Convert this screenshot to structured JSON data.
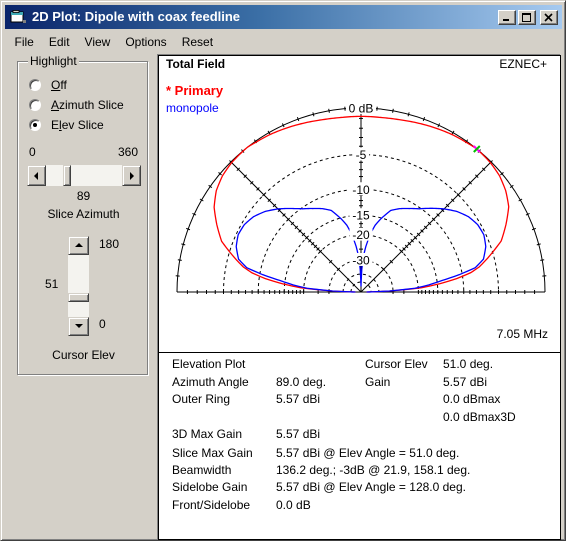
{
  "window": {
    "title": "2D Plot: Dipole with coax feedline"
  },
  "menu": [
    "File",
    "Edit",
    "View",
    "Options",
    "Reset"
  ],
  "highlight": {
    "legend": "Highlight",
    "options": [
      {
        "pre": "",
        "key": "O",
        "post": "ff",
        "selected": false
      },
      {
        "pre": "",
        "key": "A",
        "post": "zimuth Slice",
        "selected": false
      },
      {
        "pre": "E",
        "key": "l",
        "post": "ev Slice",
        "selected": true
      }
    ],
    "slice_azimuth": {
      "min": 0,
      "max": 360,
      "value": 89,
      "label": "Slice Azimuth"
    },
    "cursor_elev": {
      "min": 0,
      "max": 180,
      "value": 51,
      "label": "Cursor Elev"
    }
  },
  "plot": {
    "title": "Total Field",
    "brand": "EZNEC+",
    "legend": [
      {
        "text": "* Primary",
        "color": "#FF0000"
      },
      {
        "text": "monopole",
        "color": "#0000FF"
      }
    ],
    "frequency": "7.05 MHz"
  },
  "chart_data": {
    "type": "line",
    "coordinate_system": "polar-half (elevation 0-180 deg)",
    "title": "Total Field",
    "radial_scale": "arrl-log",
    "radial_range_db": [
      -50,
      0
    ],
    "rings_db": [
      0,
      -5,
      -10,
      -15,
      -20,
      -30,
      -40,
      -50
    ],
    "ring_labels": [
      "0 dB",
      "-5",
      "-10",
      "-15",
      "-20",
      "-30"
    ],
    "spokes_deg": [
      45,
      90,
      135
    ],
    "outer_ring_dbi": 5.57,
    "grid": true,
    "legend_position": "top-left",
    "annotation": "7.05 MHz",
    "angles_deg": [
      0,
      2,
      4,
      6,
      8,
      10,
      12,
      15,
      20,
      25,
      30,
      35,
      40,
      45,
      51,
      55,
      60,
      65,
      70,
      75,
      78,
      81,
      84,
      86,
      88,
      90,
      92,
      94,
      96,
      99,
      102,
      105,
      110,
      115,
      120,
      125,
      128,
      135,
      140,
      145,
      150,
      155,
      160,
      165,
      168,
      170,
      172,
      174,
      176,
      178,
      180
    ],
    "series": [
      {
        "name": "Primary",
        "color": "#FF0000",
        "values_db": [
          -60,
          -32,
          -19,
          -14.5,
          -11,
          -8.6,
          -7.2,
          -5.8,
          -3.6,
          -2.4,
          -1.3,
          -0.7,
          -0.3,
          -0.1,
          0,
          -0.1,
          -0.2,
          -0.35,
          -0.5,
          -0.65,
          -0.72,
          -0.77,
          -0.8,
          -0.8,
          -0.8,
          -0.8,
          -0.8,
          -0.8,
          -0.8,
          -0.77,
          -0.72,
          -0.65,
          -0.5,
          -0.35,
          -0.2,
          -0.1,
          0,
          -0.1,
          -0.3,
          -0.7,
          -1.4,
          -2.5,
          -3.7,
          -5.9,
          -7.3,
          -8.7,
          -11,
          -14.5,
          -19,
          -32,
          -60
        ]
      },
      {
        "name": "monopole",
        "color": "#0000FF",
        "values_db": [
          -60,
          -32,
          -21,
          -17,
          -14,
          -10.5,
          -7.8,
          -6.4,
          -5.6,
          -5.25,
          -5.35,
          -5.8,
          -6.6,
          -7.7,
          -9.2,
          -10.2,
          -11.1,
          -11.9,
          -12.9,
          -15.3,
          -17,
          -19.8,
          -24,
          -28,
          -36,
          -60,
          -36,
          -28,
          -24,
          -19.8,
          -17,
          -15.3,
          -12.9,
          -11.9,
          -11.1,
          -10.2,
          -9.5,
          -7.7,
          -6.6,
          -5.8,
          -5.35,
          -5.25,
          -5.6,
          -6.4,
          -7.8,
          -10.5,
          -14,
          -17,
          -21,
          -32,
          -60
        ]
      }
    ],
    "cursor": {
      "elev_deg": 51,
      "gain_db": 0
    }
  },
  "info": {
    "plot_type": "Elevation Plot",
    "cursor_elev": {
      "label": "Cursor Elev",
      "value": "51.0 deg."
    },
    "azimuth_angle": {
      "label": "Azimuth Angle",
      "value": "89.0 deg."
    },
    "gain": {
      "label": "Gain",
      "value": "5.57 dBi",
      "dbmax": "0.0 dBmax",
      "dbmax3d": "0.0 dBmax3D"
    },
    "outer_ring": {
      "label": "Outer Ring",
      "value": "5.57 dBi"
    },
    "max_3d_gain": {
      "label": "3D Max Gain",
      "value": "5.57 dBi"
    },
    "slice_max_gain": {
      "label": "Slice Max Gain",
      "value": "5.57 dBi @ Elev Angle = 51.0 deg."
    },
    "beamwidth": {
      "label": "Beamwidth",
      "value": "136.2 deg.; -3dB @ 21.9, 158.1 deg."
    },
    "sidelobe_gain": {
      "label": "Sidelobe Gain",
      "value": "5.57 dBi @ Elev Angle = 128.0 deg."
    },
    "front_sidelobe": {
      "label": "Front/Sidelobe",
      "value": "0.0 dB"
    }
  }
}
